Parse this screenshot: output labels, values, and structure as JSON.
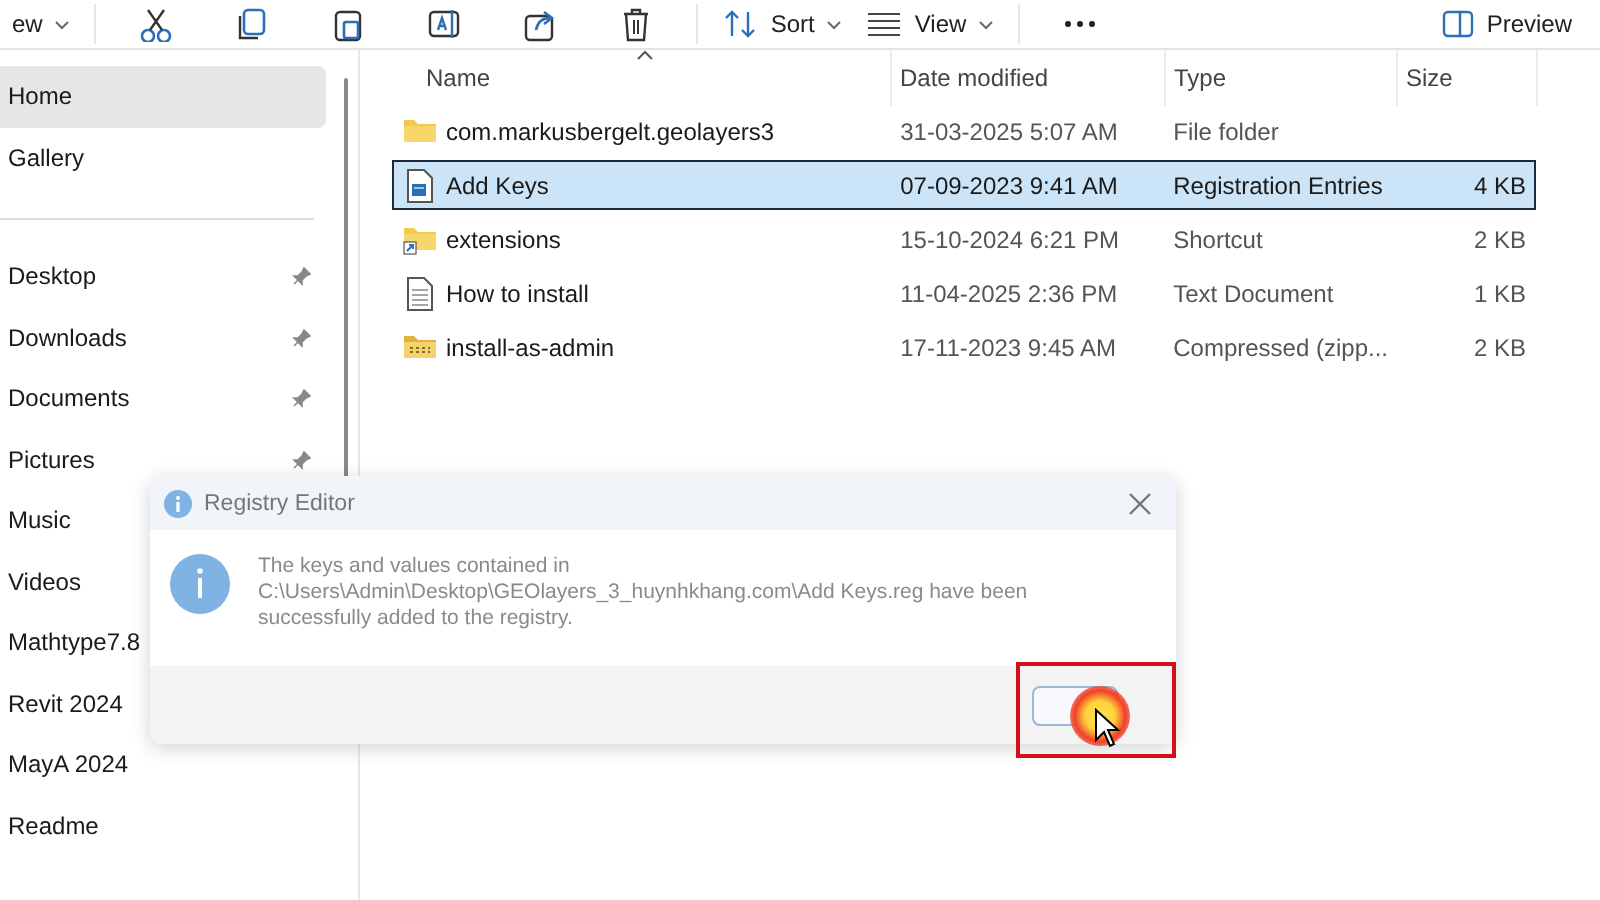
{
  "toolbar": {
    "new_label": "ew",
    "sort": "Sort",
    "view": "View",
    "preview": "Preview"
  },
  "sidebar": {
    "sections": [
      [
        {
          "label": "Home",
          "selected": true,
          "pinned": false
        },
        {
          "label": "Gallery",
          "selected": false,
          "pinned": false
        }
      ],
      [
        {
          "label": "Desktop",
          "selected": false,
          "pinned": true
        },
        {
          "label": "Downloads",
          "selected": false,
          "pinned": true
        },
        {
          "label": "Documents",
          "selected": false,
          "pinned": true
        },
        {
          "label": "Pictures",
          "selected": false,
          "pinned": true
        },
        {
          "label": "Music",
          "selected": false,
          "pinned": false
        },
        {
          "label": "Videos",
          "selected": false,
          "pinned": false
        },
        {
          "label": "Mathtype7.8",
          "selected": false,
          "pinned": false
        },
        {
          "label": "Revit 2024",
          "selected": false,
          "pinned": false
        },
        {
          "label": "MayA 2024",
          "selected": false,
          "pinned": false
        },
        {
          "label": "Readme",
          "selected": false,
          "pinned": false
        }
      ]
    ]
  },
  "file_list": {
    "columns": [
      "Name",
      "Date modified",
      "Type",
      "Size"
    ],
    "rows": [
      {
        "kind": "folder",
        "name": "com.markusbergelt.geolayers3",
        "date": "31-03-2025 5:07 AM",
        "type": "File folder",
        "size": "",
        "selected": false
      },
      {
        "kind": "registry",
        "name": "Add Keys",
        "date": "07-09-2023 9:41 AM",
        "type": "Registration Entries",
        "size": "4 KB",
        "selected": true
      },
      {
        "kind": "shortcut",
        "name": "extensions",
        "date": "15-10-2024 6:21 PM",
        "type": "Shortcut",
        "size": "2 KB",
        "selected": false
      },
      {
        "kind": "text",
        "name": "How to install",
        "date": "11-04-2025 2:36 PM",
        "type": "Text Document",
        "size": "1 KB",
        "selected": false
      },
      {
        "kind": "zip",
        "name": "install-as-admin",
        "date": "17-11-2023 9:45 AM",
        "type": "Compressed (zipp...",
        "size": "2 KB",
        "selected": false
      }
    ]
  },
  "dialog": {
    "title": "Registry Editor",
    "message": "The keys and values contained in C:\\Users\\Admin\\Desktop\\GEOlayers_3_huynhkhang.com\\Add Keys.reg have been successfully added to the registry."
  }
}
